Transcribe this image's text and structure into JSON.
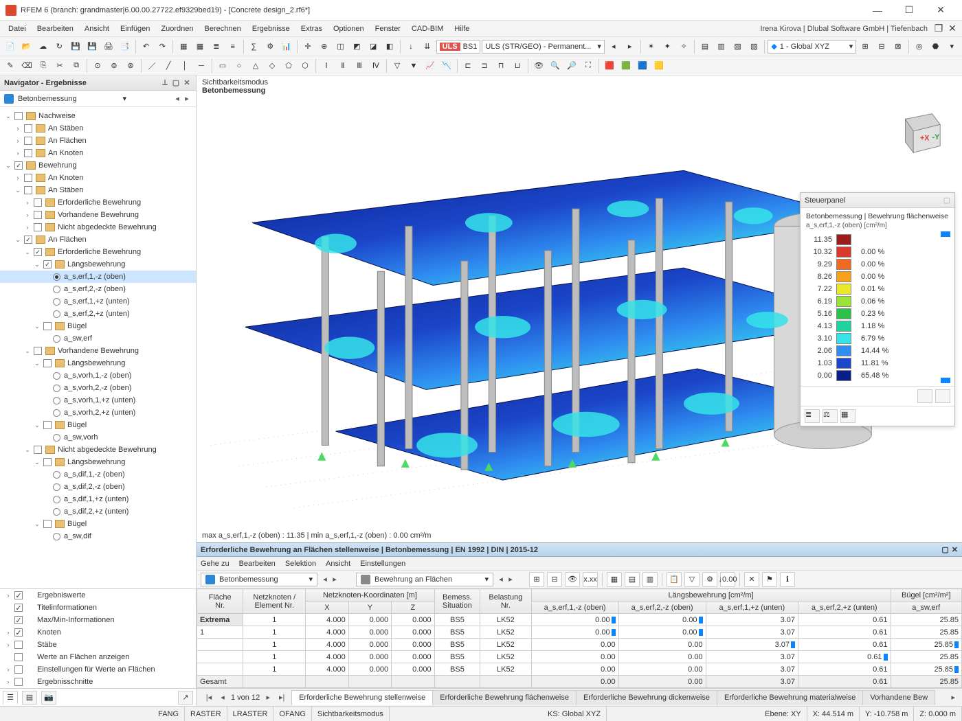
{
  "title": "RFEM 6 (branch: grandmaster|6.00.00.27722.ef9329bed19) - [Concrete design_2.rf6*]",
  "user_info": "Irena Kirova | Dlubal Software GmbH | Tiefenbach",
  "menu": [
    "Datei",
    "Bearbeiten",
    "Ansicht",
    "Einfügen",
    "Zuordnen",
    "Berechnen",
    "Ergebnisse",
    "Extras",
    "Optionen",
    "Fenster",
    "CAD-BIM",
    "Hilfe"
  ],
  "toolbar2": {
    "uls": "ULS",
    "bs": "BS1",
    "combo": "ULS (STR/GEO) - Permanent..."
  },
  "toolbar3": {
    "coord": "1 - Global XYZ"
  },
  "navigator": {
    "title": "Navigator - Ergebnisse",
    "selector": "Betonbemessung",
    "tree": [
      {
        "lvl": 0,
        "caret": "v",
        "cb": "",
        "ic": "y",
        "label": "Nachweise",
        "name": "tree-nachweise"
      },
      {
        "lvl": 1,
        "caret": ">",
        "cb": "",
        "ic": "y",
        "label": "An Stäben"
      },
      {
        "lvl": 1,
        "caret": ">",
        "cb": "",
        "ic": "y",
        "label": "An Flächen"
      },
      {
        "lvl": 1,
        "caret": ">",
        "cb": "",
        "ic": "y",
        "label": "An Knoten"
      },
      {
        "lvl": 0,
        "caret": "v",
        "cb": "c",
        "ic": "y",
        "label": "Bewehrung",
        "name": "tree-bewehrung"
      },
      {
        "lvl": 1,
        "caret": ">",
        "cb": "",
        "ic": "y",
        "label": "An Knoten"
      },
      {
        "lvl": 1,
        "caret": "v",
        "cb": "",
        "ic": "y",
        "label": "An Stäben"
      },
      {
        "lvl": 2,
        "caret": ">",
        "cb": "",
        "ic": "y",
        "label": "Erforderliche Bewehrung"
      },
      {
        "lvl": 2,
        "caret": ">",
        "cb": "",
        "ic": "y",
        "label": "Vorhandene Bewehrung"
      },
      {
        "lvl": 2,
        "caret": ">",
        "cb": "",
        "ic": "y",
        "label": "Nicht abgedeckte Bewehrung"
      },
      {
        "lvl": 1,
        "caret": "v",
        "cb": "c",
        "ic": "y",
        "label": "An Flächen"
      },
      {
        "lvl": 2,
        "caret": "v",
        "cb": "c",
        "ic": "y",
        "label": "Erforderliche Bewehrung"
      },
      {
        "lvl": 3,
        "caret": "v",
        "cb": "c",
        "ic": "y",
        "label": "Längsbewehrung"
      },
      {
        "lvl": 4,
        "rb": "sel",
        "label": "a_s,erf,1,-z (oben)",
        "selrow": true
      },
      {
        "lvl": 4,
        "rb": "",
        "label": "a_s,erf,2,-z (oben)"
      },
      {
        "lvl": 4,
        "rb": "",
        "label": "a_s,erf,1,+z (unten)"
      },
      {
        "lvl": 4,
        "rb": "",
        "label": "a_s,erf,2,+z (unten)"
      },
      {
        "lvl": 3,
        "caret": "v",
        "cb": "",
        "ic": "y",
        "label": "Bügel"
      },
      {
        "lvl": 4,
        "rb": "",
        "label": "a_sw,erf"
      },
      {
        "lvl": 2,
        "caret": "v",
        "cb": "",
        "ic": "y",
        "label": "Vorhandene Bewehrung"
      },
      {
        "lvl": 3,
        "caret": "v",
        "cb": "",
        "ic": "y",
        "label": "Längsbewehrung"
      },
      {
        "lvl": 4,
        "rb": "",
        "label": "a_s,vorh,1,-z (oben)"
      },
      {
        "lvl": 4,
        "rb": "",
        "label": "a_s,vorh,2,-z (oben)"
      },
      {
        "lvl": 4,
        "rb": "",
        "label": "a_s,vorh,1,+z (unten)"
      },
      {
        "lvl": 4,
        "rb": "",
        "label": "a_s,vorh,2,+z (unten)"
      },
      {
        "lvl": 3,
        "caret": "v",
        "cb": "",
        "ic": "y",
        "label": "Bügel"
      },
      {
        "lvl": 4,
        "rb": "",
        "label": "a_sw,vorh"
      },
      {
        "lvl": 2,
        "caret": "v",
        "cb": "",
        "ic": "y",
        "label": "Nicht abgedeckte Bewehrung"
      },
      {
        "lvl": 3,
        "caret": "v",
        "cb": "",
        "ic": "y",
        "label": "Längsbewehrung"
      },
      {
        "lvl": 4,
        "rb": "",
        "label": "a_s,dif,1,-z (oben)"
      },
      {
        "lvl": 4,
        "rb": "",
        "label": "a_s,dif,2,-z (oben)"
      },
      {
        "lvl": 4,
        "rb": "",
        "label": "a_s,dif,1,+z (unten)"
      },
      {
        "lvl": 4,
        "rb": "",
        "label": "a_s,dif,2,+z (unten)"
      },
      {
        "lvl": 3,
        "caret": "v",
        "cb": "",
        "ic": "y",
        "label": "Bügel"
      },
      {
        "lvl": 4,
        "rb": "",
        "label": "a_sw,dif"
      }
    ],
    "bottom": [
      {
        "caret": ">",
        "cb": "c",
        "label": "Ergebniswerte"
      },
      {
        "caret": "",
        "cb": "c",
        "label": "Titelinformationen"
      },
      {
        "caret": "",
        "cb": "c",
        "label": "Max/Min-Informationen"
      },
      {
        "caret": ">",
        "cb": "c",
        "label": "Knoten"
      },
      {
        "caret": ">",
        "cb": "",
        "label": "Stäbe"
      },
      {
        "caret": "",
        "cb": "",
        "label": "Werte an Flächen anzeigen"
      },
      {
        "caret": ">",
        "cb": "",
        "label": "Einstellungen für Werte an Flächen"
      },
      {
        "caret": ">",
        "cb": "",
        "label": "Ergebnisschnitte"
      }
    ]
  },
  "viewport": {
    "mode": "Sichtbarkeitsmodus",
    "subtitle": "Betonbemessung",
    "minmax": "max a_s,erf,1,-z (oben) : 11.35 | min a_s,erf,1,-z (oben) : 0.00 cm²/m"
  },
  "steuer": {
    "title": "Steuerpanel",
    "caption": "Betonbemessung | Bewehrung flächenweise",
    "sub": "a_s,erf,1,-z (oben)  [cm²/m]",
    "legend": [
      {
        "v": "11.35",
        "c": "#9b1c1c",
        "p": ""
      },
      {
        "v": "10.32",
        "c": "#d93a2e",
        "p": "0.00 %"
      },
      {
        "v": "9.29",
        "c": "#ee6a1f",
        "p": "0.00 %"
      },
      {
        "v": "8.26",
        "c": "#f6a21b",
        "p": "0.00 %"
      },
      {
        "v": "7.22",
        "c": "#e9e92a",
        "p": "0.01 %"
      },
      {
        "v": "6.19",
        "c": "#9be33a",
        "p": "0.06 %"
      },
      {
        "v": "5.16",
        "c": "#2fc04a",
        "p": "0.23 %"
      },
      {
        "v": "4.13",
        "c": "#1fd3a1",
        "p": "1.18 %"
      },
      {
        "v": "3.10",
        "c": "#35e3e9",
        "p": "6.79 %"
      },
      {
        "v": "2.06",
        "c": "#2f8df0",
        "p": "14.44 %"
      },
      {
        "v": "1.03",
        "c": "#1b46c9",
        "p": "11.81 %"
      },
      {
        "v": "0.00",
        "c": "#0a1e8a",
        "p": "65.48 %"
      }
    ]
  },
  "results": {
    "title": "Erforderliche Bewehrung an Flächen stellenweise | Betonbemessung | EN 1992 | DIN | 2015-12",
    "menu": [
      "Gehe zu",
      "Bearbeiten",
      "Selektion",
      "Ansicht",
      "Einstellungen"
    ],
    "sel1": "Betonbemessung",
    "sel2": "Bewehrung an Flächen",
    "headers_top": [
      "Fläche Nr.",
      "Netzknoten / Element Nr.",
      "Netzknoten-Koordinaten [m]",
      "Bemess. Situation",
      "Belastung Nr.",
      "Längsbewehrung [cm²/m]",
      "Bügel [cm²/m²]"
    ],
    "headers_sub": [
      "",
      "",
      "X",
      "Y",
      "Z",
      "",
      "",
      "a_s,erf,1,-z (oben)",
      "a_s,erf,2,-z (oben)",
      "a_s,erf,1,+z (unten)",
      "a_s,erf,2,+z (unten)",
      "a_sw,erf"
    ],
    "rows": [
      {
        "r": [
          "Extrema",
          "1",
          "4.000",
          "0.000",
          "0.000",
          "BS5",
          "LK52",
          "0.00",
          "0.00",
          "3.07",
          "0.61",
          "25.85"
        ],
        "mk": [
          7,
          8
        ]
      },
      {
        "r": [
          "1",
          "1",
          "4.000",
          "0.000",
          "0.000",
          "BS5",
          "LK52",
          "0.00",
          "0.00",
          "3.07",
          "0.61",
          "25.85"
        ],
        "mk": [
          7,
          8
        ]
      },
      {
        "r": [
          "",
          "1",
          "4.000",
          "0.000",
          "0.000",
          "BS5",
          "LK52",
          "0.00",
          "0.00",
          "3.07",
          "0.61",
          "25.85"
        ],
        "mk": [
          9,
          11
        ]
      },
      {
        "r": [
          "",
          "1",
          "4.000",
          "0.000",
          "0.000",
          "BS5",
          "LK52",
          "0.00",
          "0.00",
          "3.07",
          "0.61",
          "25.85"
        ],
        "mk": [
          10
        ]
      },
      {
        "r": [
          "",
          "1",
          "4.000",
          "0.000",
          "0.000",
          "BS5",
          "LK52",
          "0.00",
          "0.00",
          "3.07",
          "0.61",
          "25.85"
        ],
        "mk": [
          11
        ]
      },
      {
        "r": [
          "Gesamt",
          "",
          "",
          "",
          "",
          "",
          "",
          "0.00",
          "0.00",
          "3.07",
          "0.61",
          "25.85"
        ],
        "mk": []
      }
    ],
    "page": "1 von 12",
    "tabs": [
      "Erforderliche Bewehrung stellenweise",
      "Erforderliche Bewehrung flächenweise",
      "Erforderliche Bewehrung dickenweise",
      "Erforderliche Bewehrung materialweise",
      "Vorhandene Bew"
    ]
  },
  "status": {
    "items": [
      "FANG",
      "RASTER",
      "LRASTER",
      "OFANG",
      "Sichtbarkeitsmodus"
    ],
    "ks": "KS: Global XYZ",
    "ebene": "Ebene: XY",
    "x": "X: 44.514 m",
    "y": "Y: -10.758 m",
    "z": "Z: 0.000 m"
  }
}
